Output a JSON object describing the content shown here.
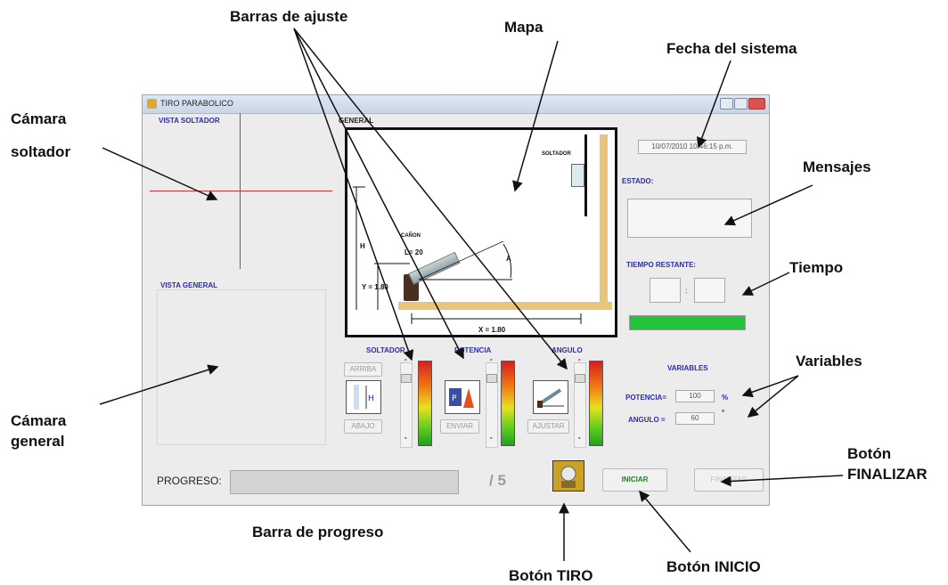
{
  "annotations": {
    "barras_ajuste": "Barras de ajuste",
    "mapa": "Mapa",
    "fecha_sistema": "Fecha del sistema",
    "camara_soltador_1": "Cámara",
    "camara_soltador_2": "soltador",
    "mensajes": "Mensajes",
    "tiempo": "Tiempo",
    "variables": "Variables",
    "camara_general_1": "Cámara",
    "camara_general_2": "general",
    "boton_finalizar_1": "Botón",
    "boton_finalizar_2": "FINALIZAR",
    "barra_progreso": "Barra de progreso",
    "boton_tiro": "Botón TIRO",
    "boton_inicio": "Botón INICIO"
  },
  "window": {
    "title": "TIRO PARABOLICO"
  },
  "views": {
    "soltador": "VISTA SOLTADOR",
    "general": "VISTA GENERAL",
    "map": "GENERAL"
  },
  "map": {
    "soltador_label": "SOLTADOR",
    "canon_label": "CAÑON",
    "l_label": "L= 20",
    "h_label": "H",
    "y_label": "Y = 1.80",
    "x_label": "X = 1.80",
    "a_label": "A"
  },
  "date": "10/07/2010 10:46:15 p.m.",
  "status": {
    "label": "ESTADO:",
    "message": ""
  },
  "time": {
    "label": "TIEMPO RESTANTE:",
    "minutes": "",
    "separator": ":",
    "seconds": "",
    "remaining_fraction": 1.0
  },
  "controls": {
    "soltador": {
      "label": "SOLTADOR",
      "up": "ARRIBA",
      "down": "ABAJO",
      "plus": "-",
      "minus": "-"
    },
    "potencia": {
      "label": "POTENCIA",
      "send": "ENVIAR",
      "plus": "-",
      "minus": "-"
    },
    "angulo": {
      "label": "ANGULO",
      "adjust": "AJUSTAR",
      "plus": "-",
      "minus": "-"
    }
  },
  "variables": {
    "title": "VARIABLES",
    "potencia_label": "POTENCIA=",
    "potencia_value": "100",
    "potencia_unit": "%",
    "angulo_label": "ANGULO =",
    "angulo_value": "60",
    "angulo_unit": "°"
  },
  "progress": {
    "label": "PROGRESO:",
    "count": "/ 5",
    "fraction": 0
  },
  "buttons": {
    "iniciar": "INICIAR",
    "finalizar": "FINALIZAR"
  },
  "colors": {
    "accent_label": "#2b2bb0",
    "progress_green": "#22c43a",
    "crosshair": "#cc3333",
    "wall": "#e8c47c"
  }
}
